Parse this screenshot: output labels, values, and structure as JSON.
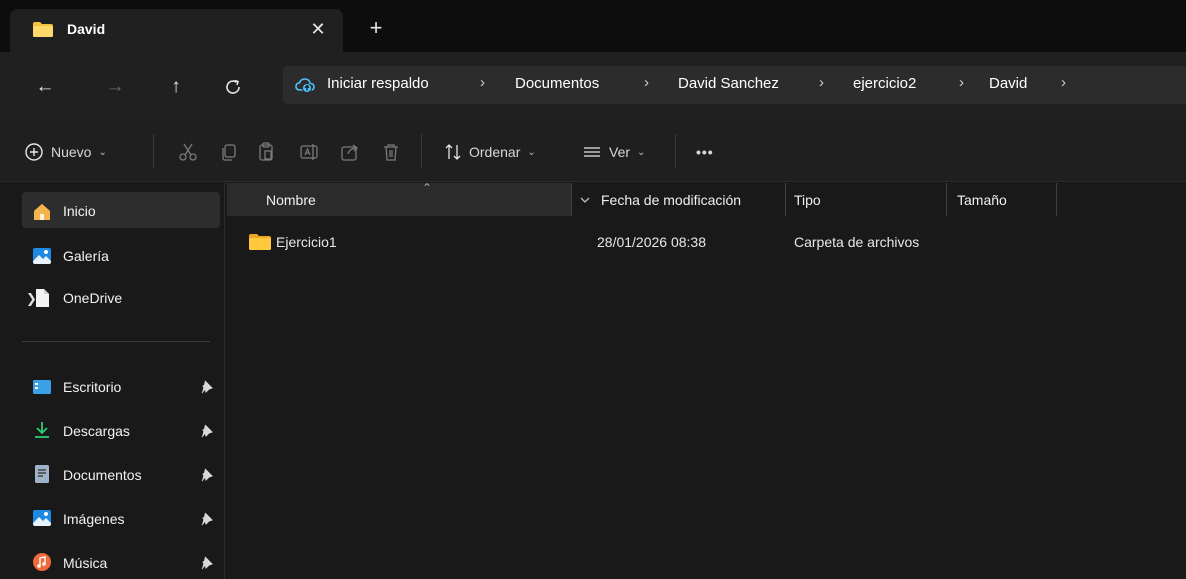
{
  "tab": {
    "title": "David",
    "close": "✕",
    "new_tab": "+"
  },
  "nav": {
    "back": "←",
    "forward": "→",
    "up": "↑",
    "refresh": "C"
  },
  "address": {
    "items": [
      "Iniciar respaldo",
      "Documentos",
      "David Sanchez",
      "ejercicio2",
      "David"
    ],
    "separator": "›"
  },
  "commands": {
    "new_label": "Nuevo",
    "sort_label": "Ordenar",
    "view_label": "Ver",
    "more_label": "•••"
  },
  "sidebar": {
    "items": [
      {
        "label": "Inicio",
        "icon": "home-icon"
      },
      {
        "label": "Galería",
        "icon": "gallery-icon"
      },
      {
        "label": "OneDrive",
        "icon": "document-icon"
      },
      {
        "label": "Escritorio",
        "icon": "desktop-icon"
      },
      {
        "label": "Descargas",
        "icon": "download-icon"
      },
      {
        "label": "Documentos",
        "icon": "documents-icon"
      },
      {
        "label": "Imágenes",
        "icon": "pictures-icon"
      },
      {
        "label": "Música",
        "icon": "music-icon"
      }
    ]
  },
  "columns": {
    "name": "Nombre",
    "modified": "Fecha de modificación",
    "type": "Tipo",
    "size": "Tamaño"
  },
  "files": [
    {
      "name": "Ejercicio1",
      "modified": "28/01/2026 08:38",
      "type": "Carpeta de archivos",
      "size": ""
    }
  ],
  "colors": {
    "folder": "#f5c33b",
    "accent": "#4cc2ff",
    "selected": "#2d2d2d"
  }
}
